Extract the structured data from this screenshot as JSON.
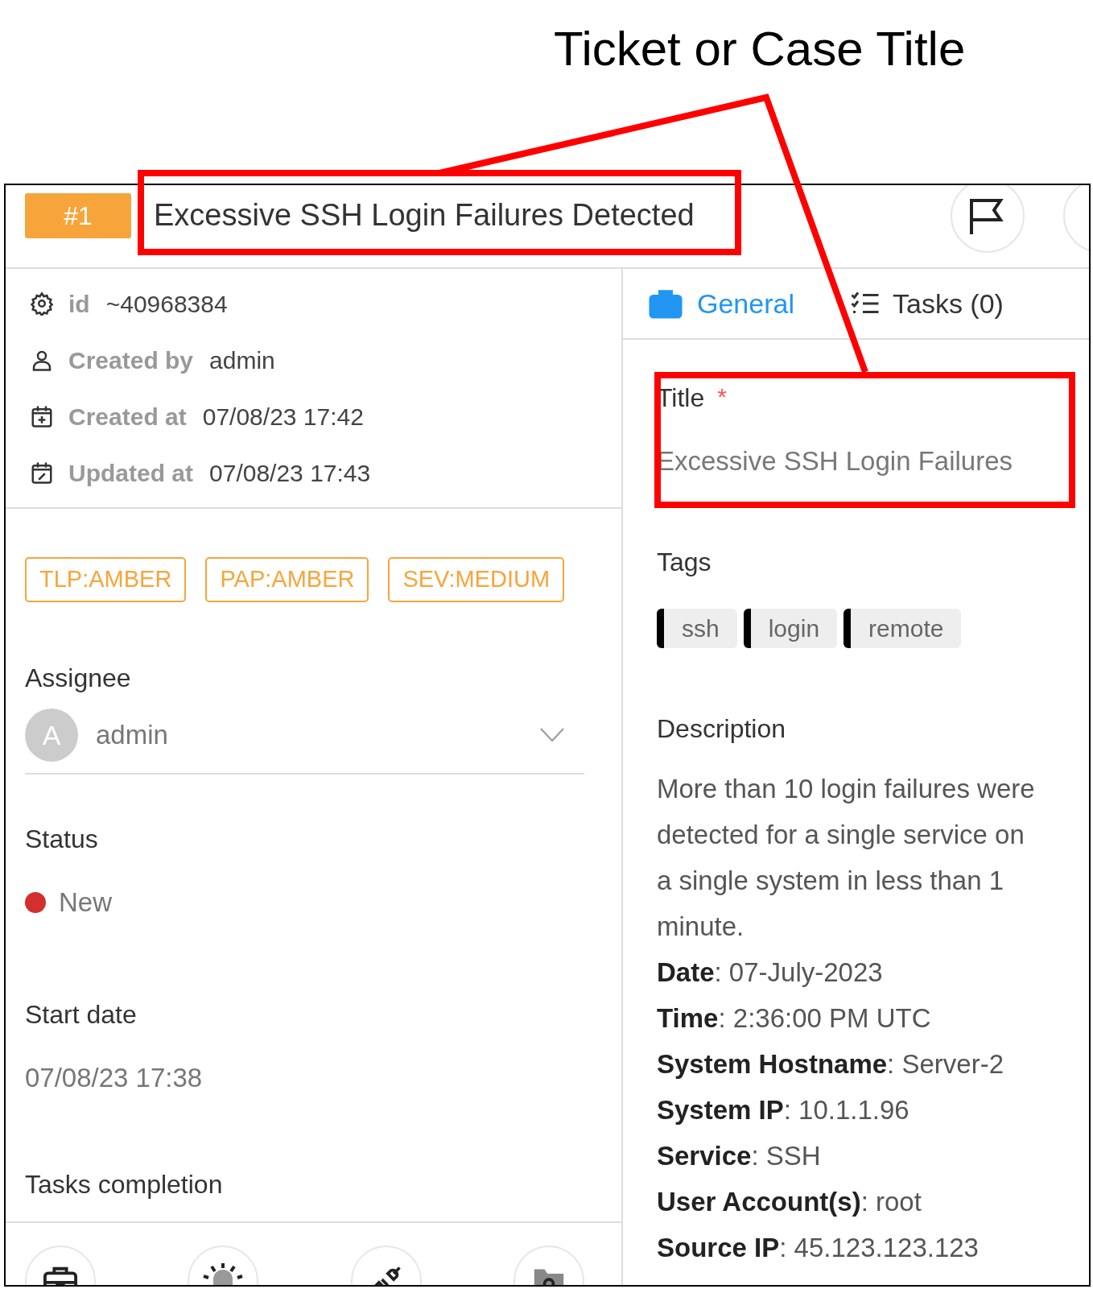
{
  "annotation": {
    "label": "Ticket or Case Title"
  },
  "header": {
    "number": "#1",
    "title": "Excessive SSH Login Failures Detected"
  },
  "details": [
    {
      "label": "id",
      "value": "~40968384"
    },
    {
      "label": "Created by",
      "value": "admin"
    },
    {
      "label": "Created at",
      "value": "07/08/23 17:42"
    },
    {
      "label": "Updated at",
      "value": "07/08/23 17:43"
    }
  ],
  "pills": [
    "TLP:AMBER",
    "PAP:AMBER",
    "SEV:MEDIUM"
  ],
  "assignee": {
    "label": "Assignee",
    "initial": "A",
    "name": "admin"
  },
  "status": {
    "label": "Status",
    "value": "New",
    "color": "#d32f2f"
  },
  "start_date": {
    "label": "Start date",
    "value": "07/08/23 17:38"
  },
  "tasks_completion": {
    "label": "Tasks completion"
  },
  "bottom_buttons": [
    {
      "kind": "briefcase"
    },
    {
      "kind": "siren"
    },
    {
      "kind": "plug"
    },
    {
      "kind": "folder-gear"
    }
  ],
  "tabs": [
    {
      "label": "General",
      "selected": true
    },
    {
      "label": "Tasks (0)",
      "selected": false
    }
  ],
  "title_field": {
    "label": "Title",
    "required_mark": "*",
    "value": "Excessive SSH Login Failures"
  },
  "tags": {
    "label": "Tags",
    "items": [
      "ssh",
      "login",
      "remote"
    ]
  },
  "description": {
    "label": "Description",
    "text": "More than 10 login failures were detected for a single service on a single system in less than 1 minute.",
    "fields": [
      "**Date**: 07-July-2023",
      "**Time**: 2:36:00 PM UTC",
      "**System Hostname**: Server-2",
      "**System IP**: 10.1.1.96",
      "**Service**: SSH",
      "**User Account(s)**: root",
      "**Source IP**: 45.123.123.123"
    ]
  }
}
